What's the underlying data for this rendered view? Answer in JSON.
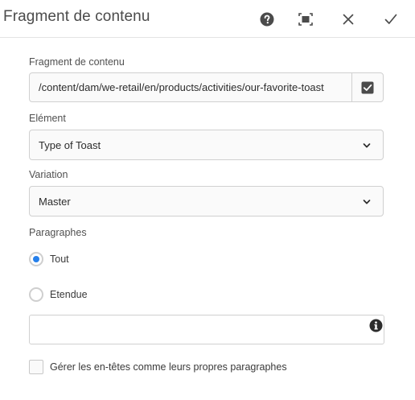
{
  "dialog": {
    "title": "Fragment de contenu",
    "header_icons": [
      "help-icon",
      "fullscreen-icon",
      "close-icon",
      "done-icon"
    ]
  },
  "fragment": {
    "label": "Fragment de contenu",
    "value": "/content/dam/we-retail/en/products/activities/our-favorite-toast",
    "picker_icon": "picker-icon"
  },
  "element": {
    "label": "Elément",
    "selected": "Type of Toast"
  },
  "variation": {
    "label": "Variation",
    "selected": "Master"
  },
  "paragraphs": {
    "label": "Paragraphes",
    "options": [
      {
        "label": "Tout",
        "checked": true
      },
      {
        "label": "Etendue",
        "checked": false
      }
    ],
    "range_value": ""
  },
  "headings": {
    "label": "Gérer les en-têtes comme leurs propres paragraphes",
    "checked": false
  },
  "colors": {
    "accent": "#2680eb",
    "border": "#d0d0d0",
    "icon": "#4b4b4b"
  }
}
